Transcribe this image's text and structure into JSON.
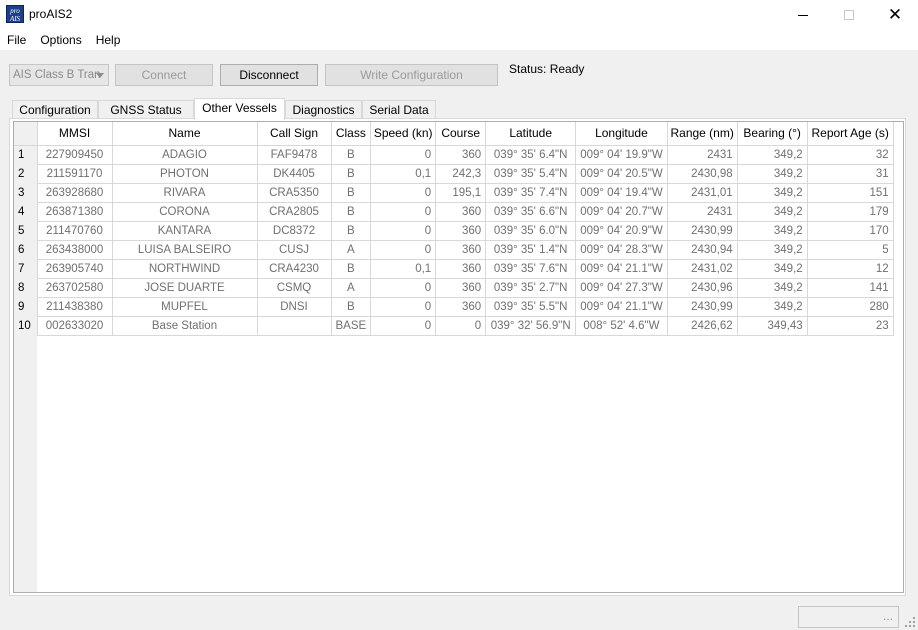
{
  "window": {
    "title": "proAIS2",
    "icon_text_top": "pro",
    "icon_text_bottom": "AIS"
  },
  "menu": [
    "File",
    "Options",
    "Help"
  ],
  "toolbar": {
    "device_combo_value": "AIS Class B Tran",
    "connect_label": "Connect",
    "disconnect_label": "Disconnect",
    "write_config_label": "Write Configuration",
    "status_text": "Status: Ready"
  },
  "tabs": [
    "Configuration",
    "GNSS Status",
    "Other Vessels",
    "Diagnostics",
    "Serial Data"
  ],
  "active_tab": "Other Vessels",
  "table": {
    "columns": [
      "MMSI",
      "Name",
      "Call Sign",
      "Class",
      "Speed (kn)",
      "Course",
      "Latitude",
      "Longitude",
      "Range (nm)",
      "Bearing (°)",
      "Report Age (s)"
    ],
    "rows": [
      [
        "1",
        "227909450",
        "ADAGIO",
        "FAF9478",
        "B",
        "0",
        "360",
        "039° 35' 6.4\"N",
        "009° 04' 19.9\"W",
        "2431",
        "349,2",
        "32"
      ],
      [
        "2",
        "211591170",
        "PHOTON",
        "DK4405",
        "B",
        "0,1",
        "242,3",
        "039° 35' 5.4\"N",
        "009° 04' 20.5\"W",
        "2430,98",
        "349,2",
        "31"
      ],
      [
        "3",
        "263928680",
        "RIVARA",
        "CRA5350",
        "B",
        "0",
        "195,1",
        "039° 35' 7.4\"N",
        "009° 04' 19.4\"W",
        "2431,01",
        "349,2",
        "151"
      ],
      [
        "4",
        "263871380",
        "CORONA",
        "CRA2805",
        "B",
        "0",
        "360",
        "039° 35' 6.6\"N",
        "009° 04' 20.7\"W",
        "2431",
        "349,2",
        "179"
      ],
      [
        "5",
        "211470760",
        "KANTARA",
        "DC8372",
        "B",
        "0",
        "360",
        "039° 35' 6.0\"N",
        "009° 04' 20.9\"W",
        "2430,99",
        "349,2",
        "170"
      ],
      [
        "6",
        "263438000",
        "LUISA BALSEIRO",
        "CUSJ",
        "A",
        "0",
        "360",
        "039° 35' 1.4\"N",
        "009° 04' 28.3\"W",
        "2430,94",
        "349,2",
        "5"
      ],
      [
        "7",
        "263905740",
        "NORTHWIND",
        "CRA4230",
        "B",
        "0,1",
        "360",
        "039° 35' 7.6\"N",
        "009° 04' 21.1\"W",
        "2431,02",
        "349,2",
        "12"
      ],
      [
        "8",
        "263702580",
        "JOSE DUARTE",
        "CSMQ",
        "A",
        "0",
        "360",
        "039° 35' 2.7\"N",
        "009° 04' 27.3\"W",
        "2430,96",
        "349,2",
        "141"
      ],
      [
        "9",
        "211438380",
        "MUPFEL",
        "DNSI",
        "B",
        "0",
        "360",
        "039° 35' 5.5\"N",
        "009° 04' 21.1\"W",
        "2430,99",
        "349,2",
        "280"
      ],
      [
        "10",
        "002633020",
        "Base Station",
        "",
        "BASE",
        "0",
        "0",
        "039° 32' 56.9\"N",
        "008° 52' 4.6\"W",
        "2426,62",
        "349,43",
        "23"
      ]
    ]
  },
  "statusbar": {
    "field_text": "..."
  }
}
